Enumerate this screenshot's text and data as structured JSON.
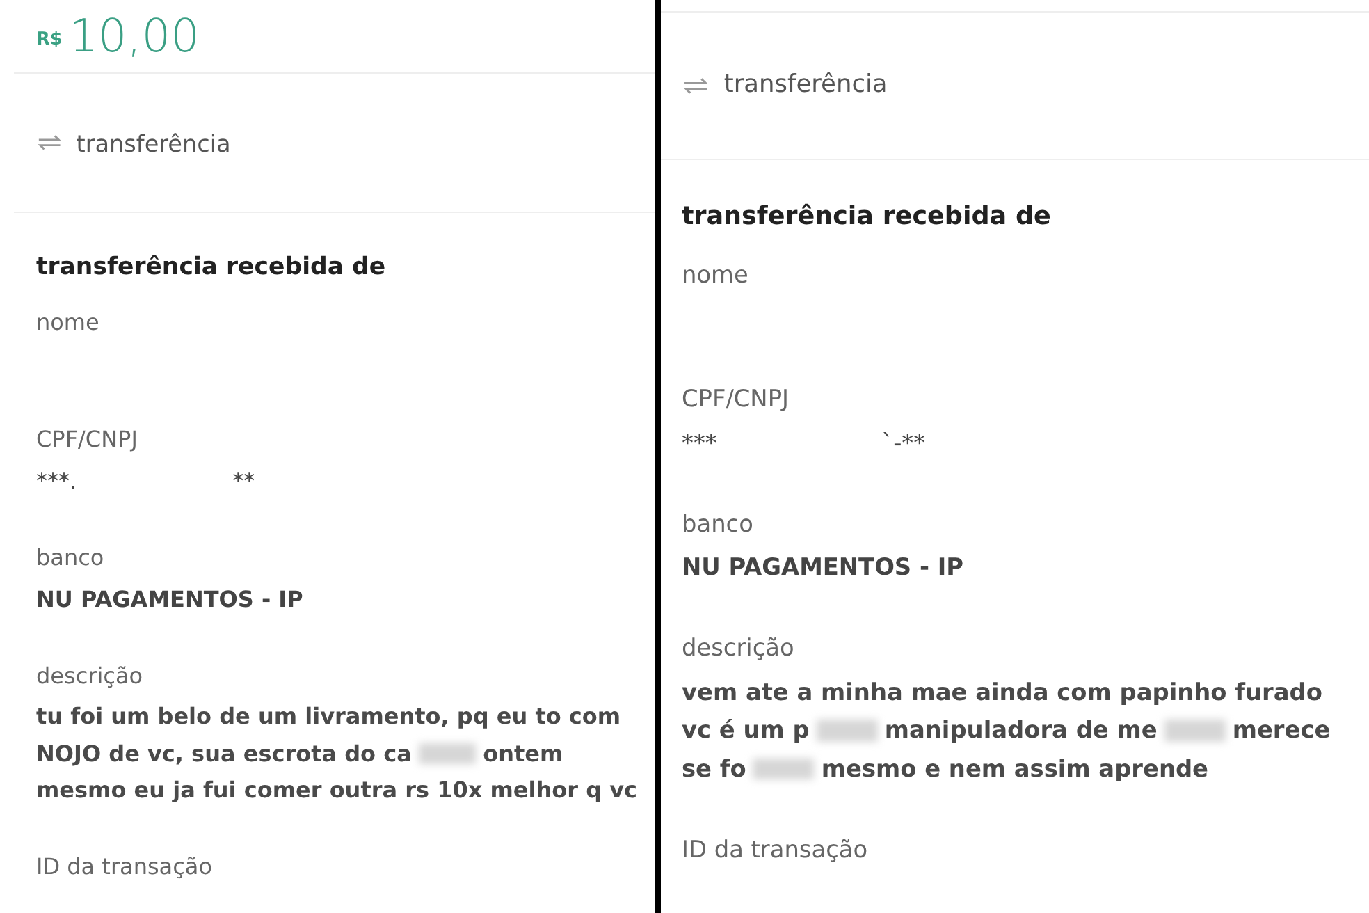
{
  "panels": [
    {
      "amount": {
        "currency": "R$",
        "value": "10,00"
      },
      "type": "transferência",
      "heading": "transferência recebida de",
      "fields": [
        {
          "label": "nome"
        },
        {
          "label": "CPF/CNPJ",
          "value": [
            {
              "kind": "text",
              "text": "***."
            },
            {
              "kind": "gap"
            },
            {
              "kind": "text",
              "text": "**"
            }
          ]
        },
        {
          "label": "banco",
          "value": [
            {
              "kind": "text",
              "text": "NU PAGAMENTOS - IP"
            }
          ]
        },
        {
          "label": "descrição",
          "lines": [
            [
              {
                "kind": "text",
                "text": "tu foi um belo de um livramento, pq eu to com"
              }
            ],
            [
              {
                "kind": "text",
                "text": "NOJO de vc, sua escrota do ca"
              },
              {
                "kind": "redacted"
              },
              {
                "kind": "text",
                "text": "ontem"
              }
            ],
            [
              {
                "kind": "text",
                "text": "mesmo eu ja fui comer outra rs 10x melhor q vc"
              }
            ]
          ]
        },
        {
          "label": "ID da transação"
        }
      ]
    },
    {
      "type": "transferência",
      "heading": "transferência recebida de",
      "fields": [
        {
          "label": "nome"
        },
        {
          "label": "CPF/CNPJ",
          "value": [
            {
              "kind": "text",
              "text": "***"
            },
            {
              "kind": "gap"
            },
            {
              "kind": "text",
              "text": "`-**"
            }
          ]
        },
        {
          "label": "banco",
          "value": [
            {
              "kind": "text",
              "text": "NU PAGAMENTOS - IP"
            }
          ]
        },
        {
          "label": "descrição",
          "lines": [
            [
              {
                "kind": "text",
                "text": "vem ate a minha mae ainda com papinho furado"
              }
            ],
            [
              {
                "kind": "text",
                "text": "vc é um p"
              },
              {
                "kind": "redacted"
              },
              {
                "kind": "text",
                "text": "manipuladora de me"
              },
              {
                "kind": "redacted"
              },
              {
                "kind": "text",
                "text": "merece"
              }
            ],
            [
              {
                "kind": "text",
                "text": "se fo"
              },
              {
                "kind": "redacted"
              },
              {
                "kind": "text",
                "text": "mesmo e nem assim aprende"
              }
            ]
          ]
        },
        {
          "label": "ID da transação"
        }
      ]
    }
  ]
}
